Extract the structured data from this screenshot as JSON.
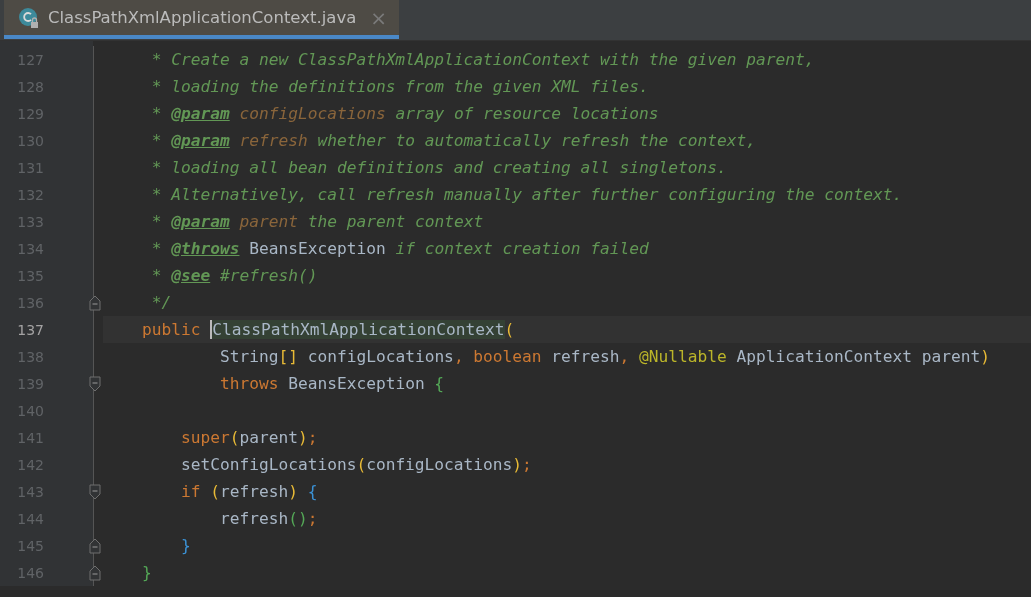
{
  "tab": {
    "title": "ClassPathXmlApplicationContext.java",
    "close": "×",
    "selected": true
  },
  "lines": [
    {
      "number": "127",
      "fold_start": false,
      "fold_end": false,
      "current": false,
      "tokens": [
        {
          "kind": "comment",
          "text": "     * Create a new ClassPathXmlApplicationContext with the given parent,"
        }
      ]
    },
    {
      "number": "128",
      "fold_start": false,
      "fold_end": false,
      "current": false,
      "tokens": [
        {
          "kind": "comment",
          "text": "     * loading the definitions from the given XML files."
        }
      ]
    },
    {
      "number": "129",
      "fold_start": false,
      "fold_end": false,
      "current": false,
      "tokens": [
        {
          "kind": "comment",
          "text": "     * "
        },
        {
          "kind": "tag",
          "text": "@param"
        },
        {
          "kind": "param",
          "text": " configLocations"
        },
        {
          "kind": "comment",
          "text": " array of resource locations"
        }
      ]
    },
    {
      "number": "130",
      "fold_start": false,
      "fold_end": false,
      "current": false,
      "tokens": [
        {
          "kind": "comment",
          "text": "     * "
        },
        {
          "kind": "tag",
          "text": "@param"
        },
        {
          "kind": "param",
          "text": " refresh"
        },
        {
          "kind": "comment",
          "text": " whether to automatically refresh the context,"
        }
      ]
    },
    {
      "number": "131",
      "fold_start": false,
      "fold_end": false,
      "current": false,
      "tokens": [
        {
          "kind": "comment",
          "text": "     * loading all bean definitions and creating all singletons."
        }
      ]
    },
    {
      "number": "132",
      "fold_start": false,
      "fold_end": false,
      "current": false,
      "tokens": [
        {
          "kind": "comment",
          "text": "     * Alternatively, call refresh manually after further configuring the context."
        }
      ]
    },
    {
      "number": "133",
      "fold_start": false,
      "fold_end": false,
      "current": false,
      "tokens": [
        {
          "kind": "comment",
          "text": "     * "
        },
        {
          "kind": "tag",
          "text": "@param"
        },
        {
          "kind": "param",
          "text": " parent"
        },
        {
          "kind": "comment",
          "text": " the parent context"
        }
      ]
    },
    {
      "number": "134",
      "fold_start": false,
      "fold_end": false,
      "current": false,
      "tokens": [
        {
          "kind": "comment",
          "text": "     * "
        },
        {
          "kind": "tag",
          "text": "@throws"
        },
        {
          "kind": "docref",
          "text": " BeansException"
        },
        {
          "kind": "comment",
          "text": " if context creation failed"
        }
      ]
    },
    {
      "number": "135",
      "fold_start": false,
      "fold_end": false,
      "current": false,
      "tokens": [
        {
          "kind": "comment",
          "text": "     * "
        },
        {
          "kind": "tag",
          "text": "@see"
        },
        {
          "kind": "comment",
          "text": " #refresh()"
        }
      ]
    },
    {
      "number": "136",
      "fold_start": false,
      "fold_end": true,
      "current": false,
      "tokens": [
        {
          "kind": "comment",
          "text": "     */"
        }
      ]
    },
    {
      "number": "137",
      "fold_start": false,
      "fold_end": false,
      "current": true,
      "tokens": [
        {
          "kind": "keyword",
          "text": "    public "
        },
        {
          "kind": "usage",
          "text": "ClassPathXmlApplicationContext"
        },
        {
          "kind": "bracket",
          "color": "#e8ba36",
          "text": "("
        }
      ]
    },
    {
      "number": "138",
      "fold_start": false,
      "fold_end": false,
      "current": false,
      "tokens": [
        {
          "kind": "plain",
          "text": "            String"
        },
        {
          "kind": "bracket",
          "color": "#e8ba36",
          "text": "[]"
        },
        {
          "kind": "plain",
          "text": " configLocations"
        },
        {
          "kind": "keyword",
          "text": ", boolean"
        },
        {
          "kind": "plain",
          "text": " refresh"
        },
        {
          "kind": "keyword",
          "text": ","
        },
        {
          "kind": "annotation",
          "text": " @Nullable"
        },
        {
          "kind": "plain",
          "text": " ApplicationContext parent"
        },
        {
          "kind": "bracket",
          "color": "#e8ba36",
          "text": ")"
        }
      ]
    },
    {
      "number": "139",
      "fold_start": true,
      "fold_end": false,
      "current": false,
      "tokens": [
        {
          "kind": "keyword",
          "text": "            throws"
        },
        {
          "kind": "plain",
          "text": " BeansException"
        },
        {
          "kind": "bracket",
          "color": "#54a857",
          "text": " {"
        }
      ]
    },
    {
      "number": "140",
      "fold_start": false,
      "fold_end": false,
      "current": false
    },
    {
      "number": "141",
      "fold_start": false,
      "fold_end": false,
      "current": false,
      "tokens": [
        {
          "kind": "keyword",
          "text": "        super"
        },
        {
          "kind": "bracket",
          "color": "#e8ba36",
          "text": "("
        },
        {
          "kind": "plain",
          "text": "parent"
        },
        {
          "kind": "bracket",
          "color": "#e8ba36",
          "text": ")"
        },
        {
          "kind": "keyword",
          "text": ";"
        }
      ]
    },
    {
      "number": "142",
      "fold_start": false,
      "fold_end": false,
      "current": false,
      "tokens": [
        {
          "kind": "plain",
          "text": "        setConfigLocations"
        },
        {
          "kind": "bracket",
          "color": "#e8ba36",
          "text": "("
        },
        {
          "kind": "plain",
          "text": "configLocations"
        },
        {
          "kind": "bracket",
          "color": "#e8ba36",
          "text": ")"
        },
        {
          "kind": "keyword",
          "text": ";"
        }
      ]
    },
    {
      "number": "143",
      "fold_start": true,
      "fold_end": false,
      "current": false,
      "tokens": [
        {
          "kind": "keyword",
          "text": "        if"
        },
        {
          "kind": "bracket",
          "color": "#e8ba36",
          "text": " ("
        },
        {
          "kind": "plain",
          "text": "refresh"
        },
        {
          "kind": "bracket",
          "color": "#e8ba36",
          "text": ")"
        },
        {
          "kind": "bracket",
          "color": "#3b92d6",
          "text": " {"
        }
      ]
    },
    {
      "number": "144",
      "fold_start": false,
      "fold_end": false,
      "current": false,
      "tokens": [
        {
          "kind": "plain",
          "text": "            refresh"
        },
        {
          "kind": "bracket",
          "color": "#54a857",
          "text": "()"
        },
        {
          "kind": "keyword",
          "text": ";"
        }
      ]
    },
    {
      "number": "145",
      "fold_start": false,
      "fold_end": true,
      "current": false,
      "tokens": [
        {
          "kind": "bracket",
          "color": "#3b92d6",
          "text": "        }"
        }
      ]
    },
    {
      "number": "146",
      "fold_start": false,
      "fold_end": true,
      "current": false,
      "tokens": [
        {
          "kind": "bracket",
          "color": "#54a857",
          "text": "    }"
        }
      ]
    }
  ]
}
